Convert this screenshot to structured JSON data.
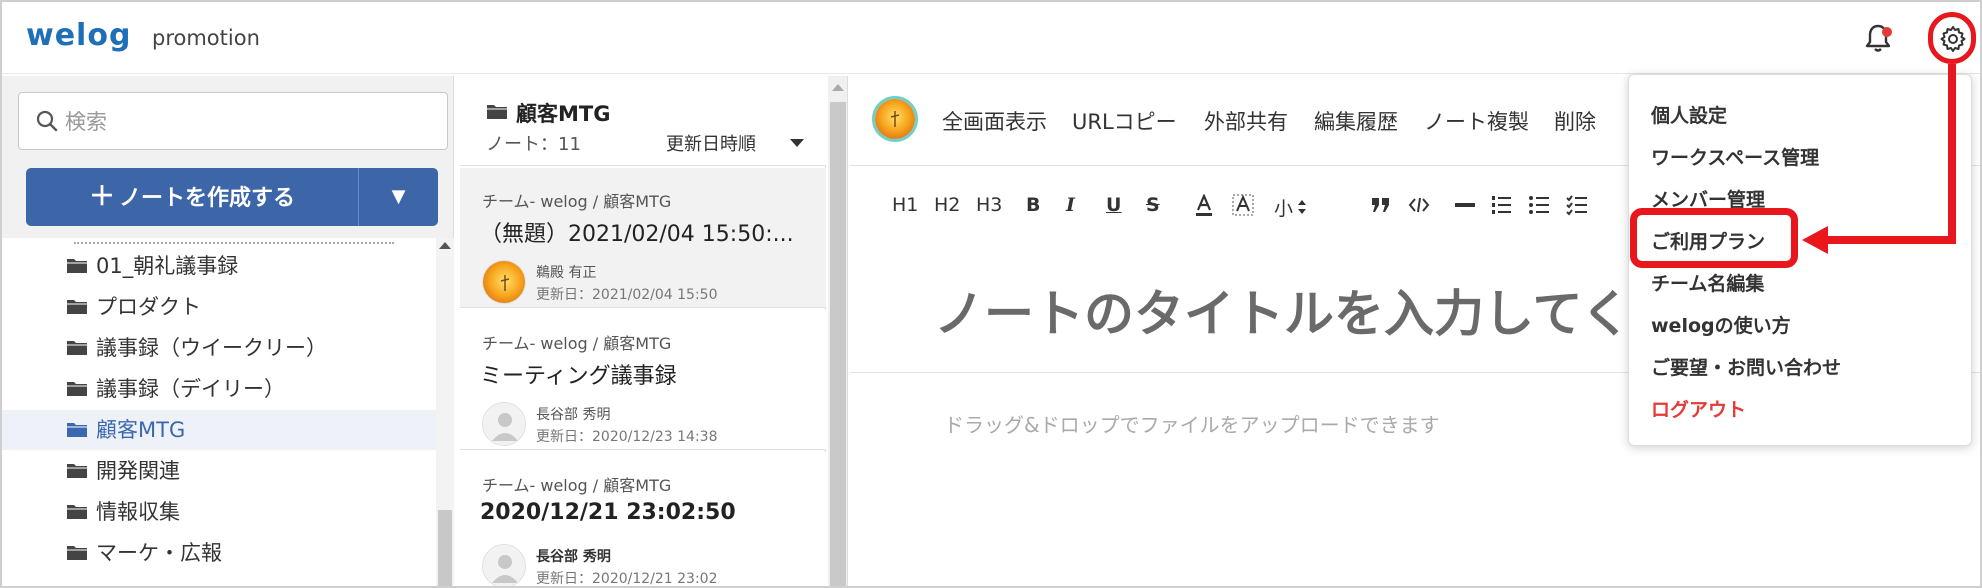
{
  "header": {
    "logo": "welog",
    "workspace": "promotion",
    "icons": {
      "bell": "bell-icon",
      "settings": "gear-icon"
    }
  },
  "sidebar": {
    "search_placeholder": "検索",
    "create_button_label": "ノートを作成する",
    "create_dropdown_glyph": "▼",
    "folders": [
      {
        "label": "01_朝礼議事録"
      },
      {
        "label": "プロダクト"
      },
      {
        "label": "議事録（ウイークリー）"
      },
      {
        "label": "議事録（デイリー）"
      },
      {
        "label": "顧客MTG",
        "active": true
      },
      {
        "label": "開発関連"
      },
      {
        "label": "情報収集"
      },
      {
        "label": "マーケ・広報"
      }
    ]
  },
  "note_list": {
    "folder_title": "顧客MTG",
    "count_label": "ノート：11",
    "sort_label": "更新日時順",
    "notes": [
      {
        "path": "チーム- welog / 顧客MTG",
        "title": "（無題）2021/02/04 15:50:...",
        "author": "鵜殿 有正",
        "updated": "更新日：2021/02/04 15:50"
      },
      {
        "path": "チーム- welog / 顧客MTG",
        "title": "ミーティング議事録",
        "author": "長谷部 秀明",
        "updated": "更新日：2020/12/23 14:38"
      },
      {
        "path": "チーム- welog / 顧客MTG",
        "title": "2020/12/21 23:02:50",
        "author": "長谷部 秀明",
        "updated": "更新日：2020/12/21 23:02"
      }
    ]
  },
  "editor": {
    "actions": [
      "全画面表示",
      "URLコピー",
      "外部共有",
      "編集履歴",
      "ノート複製",
      "削除"
    ],
    "format_tools": {
      "h1": "H1",
      "h2": "H2",
      "h3": "H3",
      "bold": "B",
      "italic": "I",
      "underline": "U",
      "strike": "S",
      "size": "小"
    },
    "title_placeholder": "ノートのタイトルを入力してくだ",
    "body_placeholder": "ドラッグ&ドロップでファイルをアップロードできます"
  },
  "settings_menu": {
    "items": [
      {
        "label": "個人設定"
      },
      {
        "label": "ワークスペース管理"
      },
      {
        "label": "メンバー管理"
      },
      {
        "label": "ご利用プラン",
        "highlighted": true
      },
      {
        "label": "チーム名編集"
      },
      {
        "label": "welogの使い方"
      },
      {
        "label": "ご要望・お問い合わせ"
      },
      {
        "label": "ログアウト",
        "danger": true
      }
    ]
  },
  "colors": {
    "brand": "#1f6fb8",
    "primary_button": "#3c66a8",
    "annotation_red": "#e8161d",
    "logout_red": "#e53935",
    "active_folder": "#3a68b0"
  }
}
